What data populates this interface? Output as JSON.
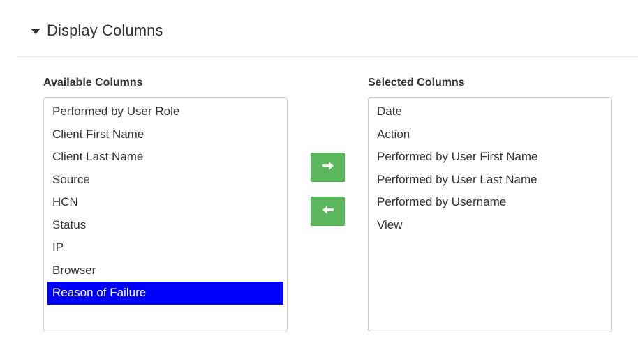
{
  "section": {
    "title": "Display Columns",
    "icon": "caret-down-icon"
  },
  "available": {
    "label": "Available Columns",
    "items": [
      "Performed by User Role",
      "Client First Name",
      "Client Last Name",
      "Source",
      "HCN",
      "Status",
      "IP",
      "Browser",
      "Reason of Failure"
    ],
    "selected_item": "Reason of Failure"
  },
  "selected": {
    "label": "Selected Columns",
    "items": [
      "Date",
      "Action",
      "Performed by User First Name",
      "Performed by User Last Name",
      "Performed by Username",
      "View"
    ]
  },
  "buttons": {
    "add_icon": "arrow-right-icon",
    "remove_icon": "arrow-left-icon",
    "color": "#5cb85c"
  },
  "colors": {
    "selection": "#0000ff",
    "text": "#333333",
    "border": "#cccccc"
  }
}
